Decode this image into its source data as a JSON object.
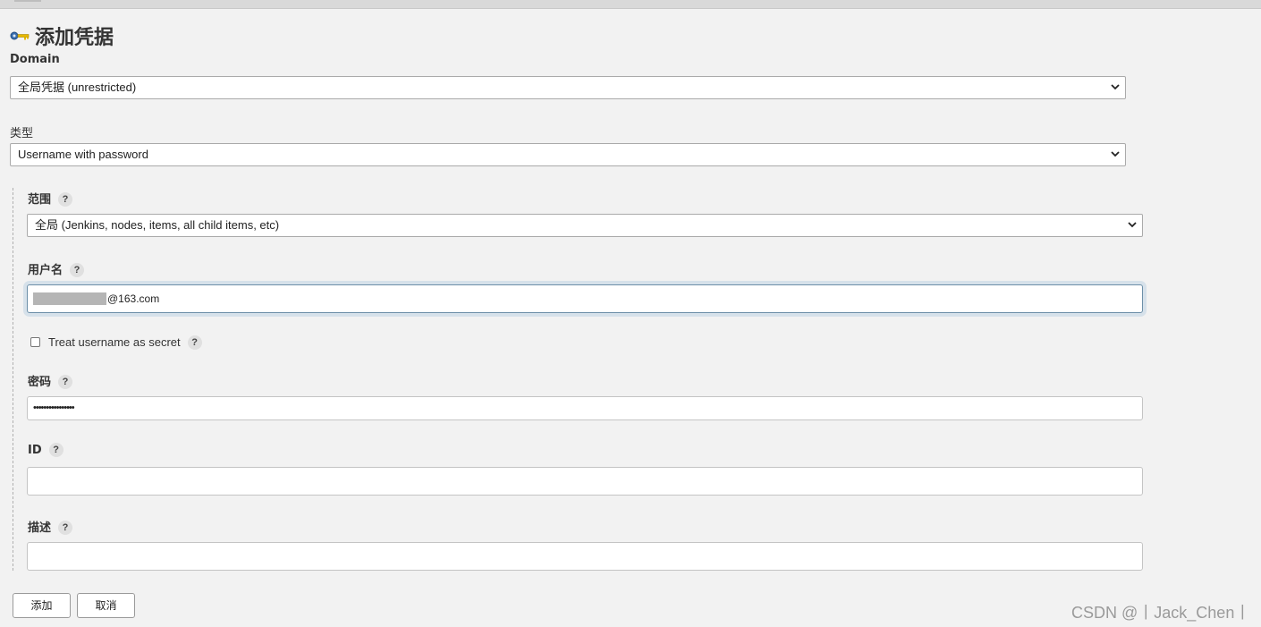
{
  "page": {
    "title": "添加凭据",
    "title_icon": "key-icon"
  },
  "domain": {
    "label": "Domain",
    "selected": "全局凭据 (unrestricted)"
  },
  "kind": {
    "label": "类型",
    "selected": "Username with password"
  },
  "scope": {
    "label": "范围",
    "selected": "全局 (Jenkins, nodes, items, all child items, etc)"
  },
  "username": {
    "label": "用户名",
    "value_suffix": "@163.com"
  },
  "username_secret": {
    "label": "Treat username as secret",
    "checked": false
  },
  "password": {
    "label": "密码",
    "value": "••••••••••••••••"
  },
  "id": {
    "label": "ID",
    "value": ""
  },
  "description": {
    "label": "描述",
    "value": ""
  },
  "help_glyph": "?",
  "buttons": {
    "add": "添加",
    "cancel": "取消"
  },
  "watermark": "CSDN @丨Jack_Chen丨",
  "colors": {
    "background": "#f2f2f2",
    "focus_ring": "#d6e1ea",
    "focus_border": "#6d8fa8"
  }
}
